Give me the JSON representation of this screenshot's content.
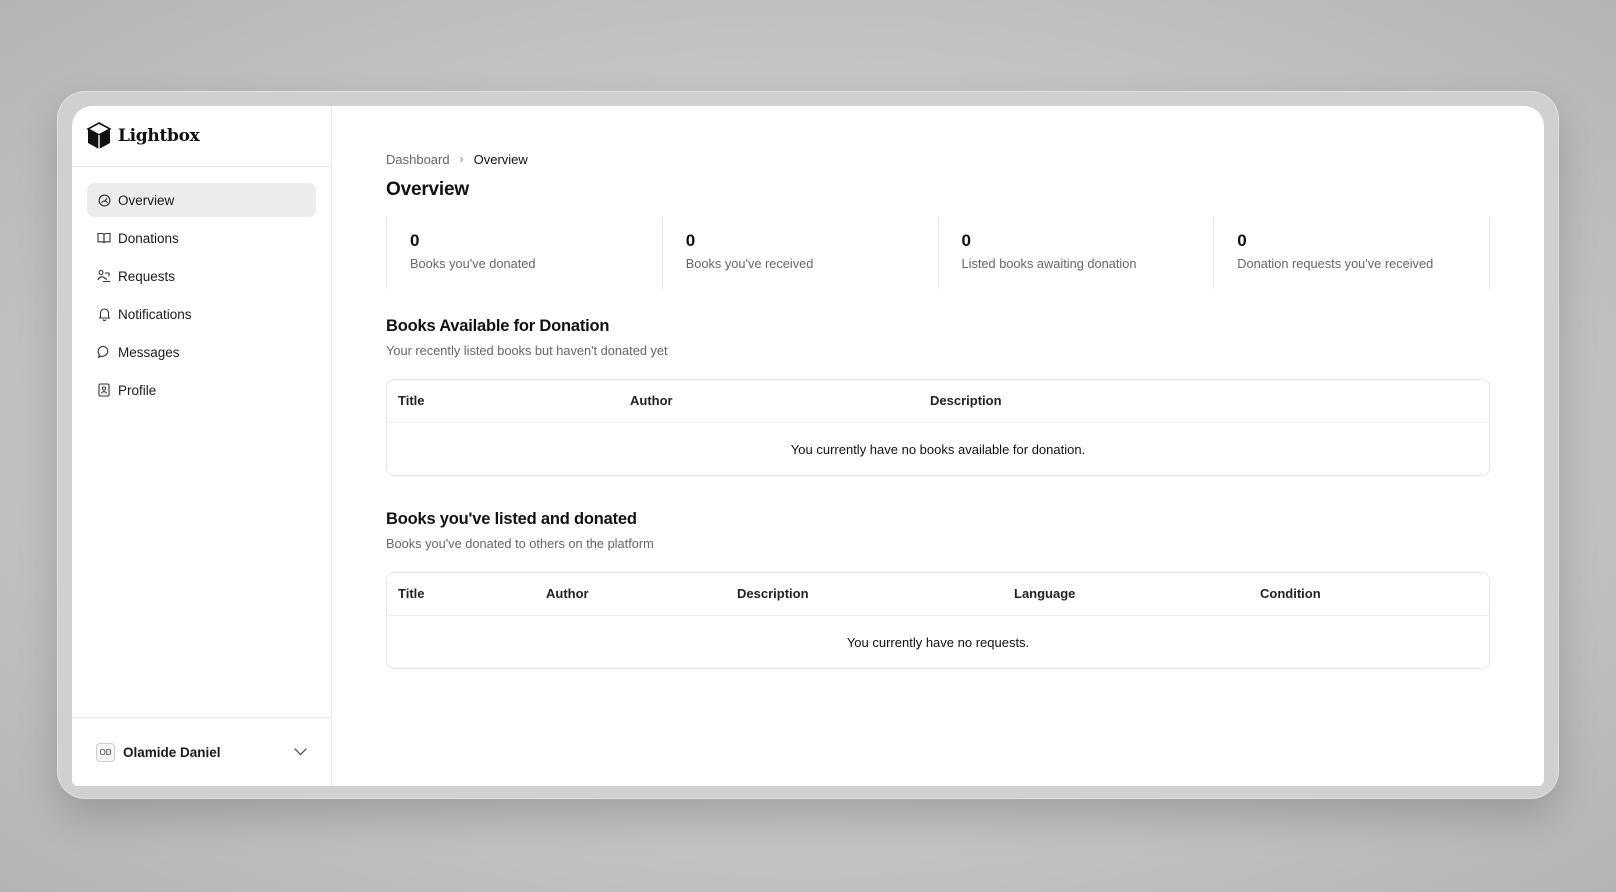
{
  "brand": {
    "name": "Lightbox",
    "logo_icon": "cube-icon"
  },
  "sidebar": {
    "items": [
      {
        "label": "Overview",
        "icon": "gauge-icon",
        "active": true
      },
      {
        "label": "Donations",
        "icon": "book-open-icon"
      },
      {
        "label": "Requests",
        "icon": "handshake-icon"
      },
      {
        "label": "Notifications",
        "icon": "bell-icon"
      },
      {
        "label": "Messages",
        "icon": "chat-bubble-icon"
      },
      {
        "label": "Profile",
        "icon": "contact-card-icon"
      }
    ]
  },
  "user": {
    "initials": "OD",
    "name": "Olamide Daniel",
    "menu_icon": "chevron-down-icon"
  },
  "breadcrumb": {
    "parent": "Dashboard",
    "separator": "›",
    "current": "Overview"
  },
  "page": {
    "title": "Overview"
  },
  "stats": [
    {
      "value": "0",
      "label": "Books you've donated"
    },
    {
      "value": "0",
      "label": "Books you've received"
    },
    {
      "value": "0",
      "label": "Listed books awaiting donation"
    },
    {
      "value": "0",
      "label": "Donation requests you've received"
    }
  ],
  "available": {
    "title": "Books Available for Donation",
    "subtitle": "Your recently listed books but haven't donated yet",
    "columns": [
      "Title",
      "Author",
      "Description"
    ],
    "empty": "You currently have no books available for donation."
  },
  "donated": {
    "title": "Books you've listed and donated",
    "subtitle": "Books you've donated to others on the platform",
    "columns": [
      "Title",
      "Author",
      "Description",
      "Language",
      "Condition"
    ],
    "empty": "You currently have no requests."
  },
  "colors": {
    "active_nav_bg": "#ececec",
    "border": "#e6e6e6",
    "muted_text": "#666666"
  }
}
